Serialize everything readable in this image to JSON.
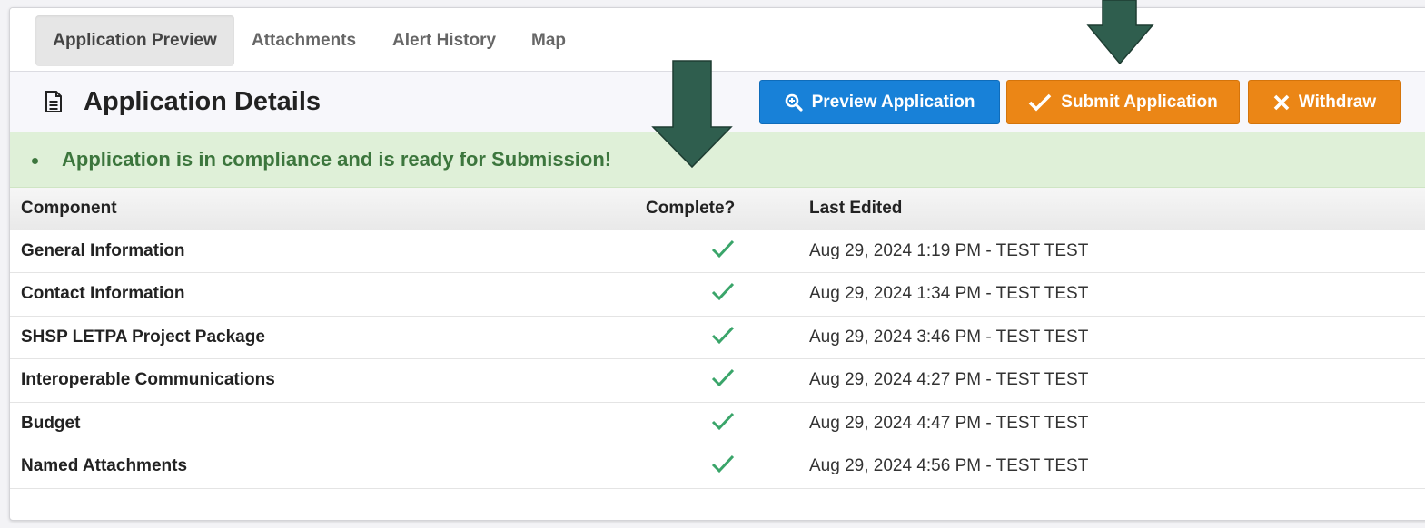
{
  "tabs": [
    {
      "label": "Application Preview",
      "active": true
    },
    {
      "label": "Attachments",
      "active": false
    },
    {
      "label": "Alert History",
      "active": false
    },
    {
      "label": "Map",
      "active": false
    }
  ],
  "header": {
    "title": "Application Details",
    "buttons": {
      "preview": "Preview Application",
      "submit": "Submit Application",
      "withdraw": "Withdraw"
    }
  },
  "alert": {
    "message": "Application is in compliance and is ready for Submission!"
  },
  "table": {
    "columns": [
      "Component",
      "Complete?",
      "Last Edited"
    ],
    "rows": [
      {
        "component": "General Information",
        "complete": true,
        "last_edited": "Aug 29, 2024 1:19 PM - TEST TEST"
      },
      {
        "component": "Contact Information",
        "complete": true,
        "last_edited": "Aug 29, 2024 1:34 PM - TEST TEST"
      },
      {
        "component": "SHSP LETPA Project Package",
        "complete": true,
        "last_edited": "Aug 29, 2024 3:46 PM - TEST TEST"
      },
      {
        "component": "Interoperable Communications",
        "complete": true,
        "last_edited": "Aug 29, 2024 4:27 PM - TEST TEST"
      },
      {
        "component": "Budget",
        "complete": true,
        "last_edited": "Aug 29, 2024 4:47 PM - TEST TEST"
      },
      {
        "component": "Named Attachments",
        "complete": true,
        "last_edited": "Aug 29, 2024 4:56 PM - TEST TEST"
      }
    ]
  },
  "colors": {
    "primary_blue": "#1881d8",
    "accent_orange": "#eb8616",
    "success_green": "#3c763d",
    "success_bg": "#dff0d8",
    "check_green": "#3aa56a",
    "annotation_arrow": "#2f5e4e"
  },
  "icons": {
    "title": "document-icon",
    "preview": "magnifier-icon",
    "submit": "checkmark-icon",
    "withdraw": "x-icon",
    "complete": "checkmark-icon"
  }
}
